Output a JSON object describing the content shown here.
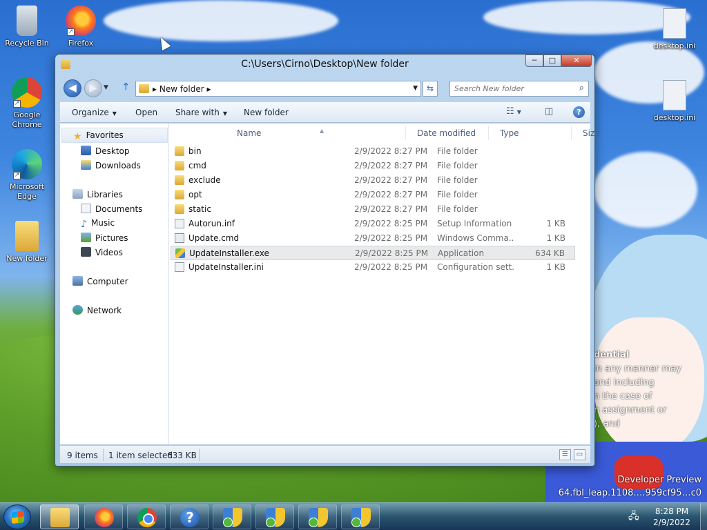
{
  "desktop": {
    "icons": [
      {
        "label": "Recycle Bin",
        "icon": "recycle-bin-icon"
      },
      {
        "label": "Firefox",
        "icon": "firefox-icon"
      },
      {
        "label": "Google Chrome",
        "icon": "chrome-icon"
      },
      {
        "label": "Microsoft Edge",
        "icon": "edge-icon"
      },
      {
        "label": "New folder",
        "icon": "folder-icon"
      },
      {
        "label": "desktop.ini",
        "icon": "settings-file-icon"
      },
      {
        "label": "desktop.ini",
        "icon": "settings-file-icon"
      }
    ],
    "watermark": {
      "line1": "dential",
      "line2": "in any manner may",
      "line3": "and including",
      "line4": "n the case of",
      "line5": "n assignment or",
      "line6": "), and"
    },
    "build": {
      "line1": "Developer Preview",
      "line2": "64.fbl_leap.1108….959cf95…c0"
    }
  },
  "window": {
    "title": "C:\\Users\\Cirno\\Desktop\\New folder",
    "caption": {
      "minimize": "─",
      "maximize": "□",
      "close": "✕"
    },
    "address": {
      "crumb": "New folder"
    },
    "search": {
      "placeholder": "Search New folder"
    },
    "commands": {
      "organize": "Organize",
      "open": "Open",
      "share_with": "Share with",
      "new_folder": "New folder"
    },
    "nav": {
      "favorites": "Favorites",
      "desktop": "Desktop",
      "downloads": "Downloads",
      "libraries": "Libraries",
      "documents": "Documents",
      "music": "Music",
      "pictures": "Pictures",
      "videos": "Videos",
      "computer": "Computer",
      "network": "Network"
    },
    "columns": {
      "name": "Name",
      "date": "Date modified",
      "type": "Type",
      "size": "Size"
    },
    "files": [
      {
        "name": "bin",
        "date": "2/9/2022 8:27 PM",
        "type": "File folder",
        "size": ""
      },
      {
        "name": "cmd",
        "date": "2/9/2022 8:27 PM",
        "type": "File folder",
        "size": ""
      },
      {
        "name": "exclude",
        "date": "2/9/2022 8:27 PM",
        "type": "File folder",
        "size": ""
      },
      {
        "name": "opt",
        "date": "2/9/2022 8:27 PM",
        "type": "File folder",
        "size": ""
      },
      {
        "name": "static",
        "date": "2/9/2022 8:27 PM",
        "type": "File folder",
        "size": ""
      },
      {
        "name": "Autorun.inf",
        "date": "2/9/2022 8:25 PM",
        "type": "Setup Information",
        "size": "1 KB"
      },
      {
        "name": "Update.cmd",
        "date": "2/9/2022 8:25 PM",
        "type": "Windows Comma...",
        "size": "1 KB"
      },
      {
        "name": "UpdateInstaller.exe",
        "date": "2/9/2022 8:25 PM",
        "type": "Application",
        "size": "634 KB"
      },
      {
        "name": "UpdateInstaller.ini",
        "date": "2/9/2022 8:25 PM",
        "type": "Configuration sett...",
        "size": "1 KB"
      }
    ],
    "status": {
      "items": "9 items",
      "selected": "1 item selected",
      "size": "633 KB"
    }
  },
  "taskbar": {
    "clock_time": "8:28 PM",
    "clock_date": "2/9/2022",
    "help_glyph": "?"
  },
  "colors": {
    "accent": "#1f56b1",
    "selection": "#e9eaeb",
    "folder": "#dca83a"
  }
}
